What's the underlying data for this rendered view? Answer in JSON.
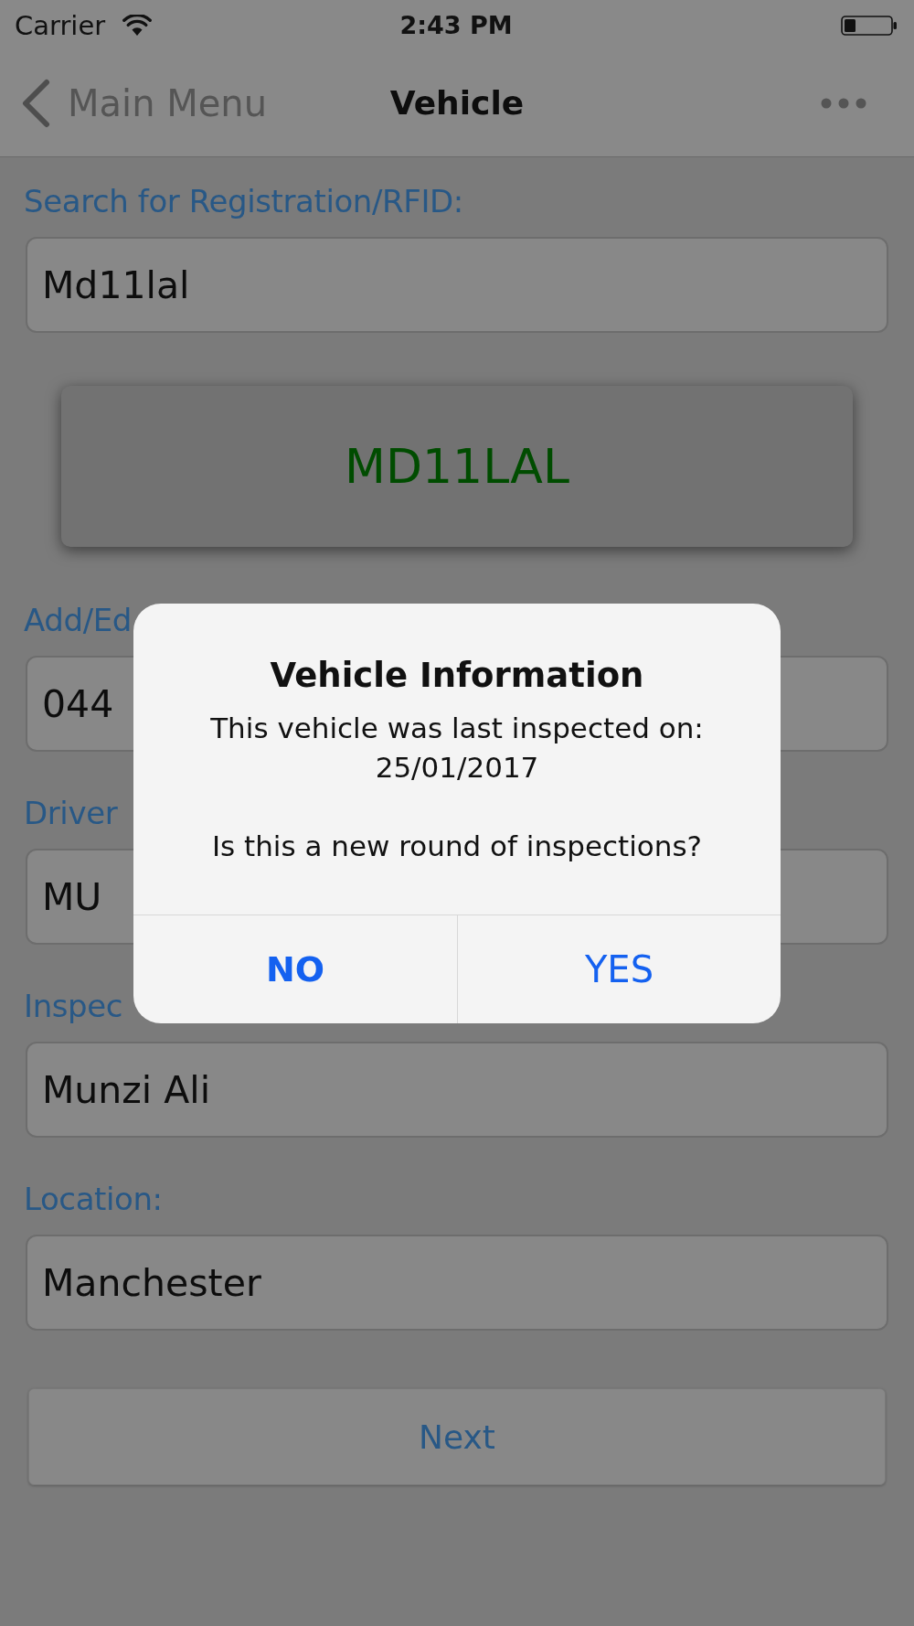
{
  "status_bar": {
    "carrier": "Carrier",
    "time": "2:43 PM"
  },
  "nav_bar": {
    "back_label": "Main Menu",
    "title": "Vehicle"
  },
  "form": {
    "items": [
      {
        "kind": "field",
        "label": "Search for Registration/RFID:",
        "value": "Md11lal"
      },
      {
        "kind": "plate",
        "text": "MD11LAL"
      },
      {
        "kind": "field",
        "label": "Add/Ed",
        "value": "044"
      },
      {
        "kind": "field",
        "label": "Driver",
        "value": "MU"
      },
      {
        "kind": "field",
        "label": "Inspec",
        "value": "Munzi Ali"
      },
      {
        "kind": "field",
        "label": "Location:",
        "value": "Manchester"
      }
    ],
    "next_button": "Next"
  },
  "alert": {
    "title": "Vehicle Information",
    "message": "This vehicle was last inspected on:\n25/01/2017\n\nIs this a new round of inspections?",
    "buttons": [
      {
        "label": "NO",
        "kind": "preferred"
      },
      {
        "label": "YES",
        "kind": "default"
      }
    ]
  }
}
